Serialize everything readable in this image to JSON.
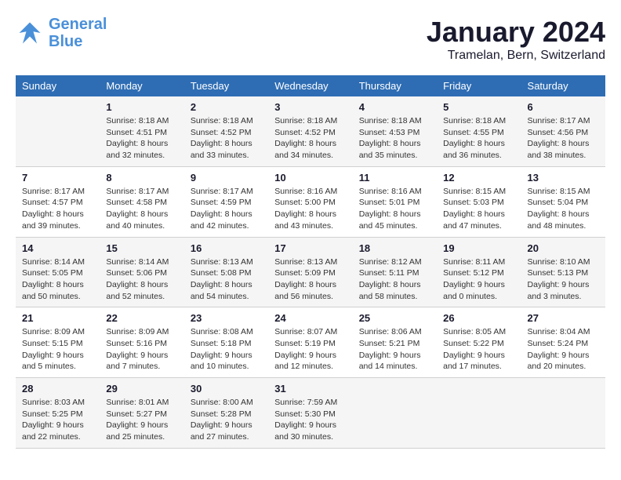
{
  "header": {
    "logo_line1": "General",
    "logo_line2": "Blue",
    "month_title": "January 2024",
    "subtitle": "Tramelan, Bern, Switzerland"
  },
  "weekdays": [
    "Sunday",
    "Monday",
    "Tuesday",
    "Wednesday",
    "Thursday",
    "Friday",
    "Saturday"
  ],
  "weeks": [
    [
      {
        "day": "",
        "info": ""
      },
      {
        "day": "1",
        "info": "Sunrise: 8:18 AM\nSunset: 4:51 PM\nDaylight: 8 hours\nand 32 minutes."
      },
      {
        "day": "2",
        "info": "Sunrise: 8:18 AM\nSunset: 4:52 PM\nDaylight: 8 hours\nand 33 minutes."
      },
      {
        "day": "3",
        "info": "Sunrise: 8:18 AM\nSunset: 4:52 PM\nDaylight: 8 hours\nand 34 minutes."
      },
      {
        "day": "4",
        "info": "Sunrise: 8:18 AM\nSunset: 4:53 PM\nDaylight: 8 hours\nand 35 minutes."
      },
      {
        "day": "5",
        "info": "Sunrise: 8:18 AM\nSunset: 4:55 PM\nDaylight: 8 hours\nand 36 minutes."
      },
      {
        "day": "6",
        "info": "Sunrise: 8:17 AM\nSunset: 4:56 PM\nDaylight: 8 hours\nand 38 minutes."
      }
    ],
    [
      {
        "day": "7",
        "info": "Sunrise: 8:17 AM\nSunset: 4:57 PM\nDaylight: 8 hours\nand 39 minutes."
      },
      {
        "day": "8",
        "info": "Sunrise: 8:17 AM\nSunset: 4:58 PM\nDaylight: 8 hours\nand 40 minutes."
      },
      {
        "day": "9",
        "info": "Sunrise: 8:17 AM\nSunset: 4:59 PM\nDaylight: 8 hours\nand 42 minutes."
      },
      {
        "day": "10",
        "info": "Sunrise: 8:16 AM\nSunset: 5:00 PM\nDaylight: 8 hours\nand 43 minutes."
      },
      {
        "day": "11",
        "info": "Sunrise: 8:16 AM\nSunset: 5:01 PM\nDaylight: 8 hours\nand 45 minutes."
      },
      {
        "day": "12",
        "info": "Sunrise: 8:15 AM\nSunset: 5:03 PM\nDaylight: 8 hours\nand 47 minutes."
      },
      {
        "day": "13",
        "info": "Sunrise: 8:15 AM\nSunset: 5:04 PM\nDaylight: 8 hours\nand 48 minutes."
      }
    ],
    [
      {
        "day": "14",
        "info": "Sunrise: 8:14 AM\nSunset: 5:05 PM\nDaylight: 8 hours\nand 50 minutes."
      },
      {
        "day": "15",
        "info": "Sunrise: 8:14 AM\nSunset: 5:06 PM\nDaylight: 8 hours\nand 52 minutes."
      },
      {
        "day": "16",
        "info": "Sunrise: 8:13 AM\nSunset: 5:08 PM\nDaylight: 8 hours\nand 54 minutes."
      },
      {
        "day": "17",
        "info": "Sunrise: 8:13 AM\nSunset: 5:09 PM\nDaylight: 8 hours\nand 56 minutes."
      },
      {
        "day": "18",
        "info": "Sunrise: 8:12 AM\nSunset: 5:11 PM\nDaylight: 8 hours\nand 58 minutes."
      },
      {
        "day": "19",
        "info": "Sunrise: 8:11 AM\nSunset: 5:12 PM\nDaylight: 9 hours\nand 0 minutes."
      },
      {
        "day": "20",
        "info": "Sunrise: 8:10 AM\nSunset: 5:13 PM\nDaylight: 9 hours\nand 3 minutes."
      }
    ],
    [
      {
        "day": "21",
        "info": "Sunrise: 8:09 AM\nSunset: 5:15 PM\nDaylight: 9 hours\nand 5 minutes."
      },
      {
        "day": "22",
        "info": "Sunrise: 8:09 AM\nSunset: 5:16 PM\nDaylight: 9 hours\nand 7 minutes."
      },
      {
        "day": "23",
        "info": "Sunrise: 8:08 AM\nSunset: 5:18 PM\nDaylight: 9 hours\nand 10 minutes."
      },
      {
        "day": "24",
        "info": "Sunrise: 8:07 AM\nSunset: 5:19 PM\nDaylight: 9 hours\nand 12 minutes."
      },
      {
        "day": "25",
        "info": "Sunrise: 8:06 AM\nSunset: 5:21 PM\nDaylight: 9 hours\nand 14 minutes."
      },
      {
        "day": "26",
        "info": "Sunrise: 8:05 AM\nSunset: 5:22 PM\nDaylight: 9 hours\nand 17 minutes."
      },
      {
        "day": "27",
        "info": "Sunrise: 8:04 AM\nSunset: 5:24 PM\nDaylight: 9 hours\nand 20 minutes."
      }
    ],
    [
      {
        "day": "28",
        "info": "Sunrise: 8:03 AM\nSunset: 5:25 PM\nDaylight: 9 hours\nand 22 minutes."
      },
      {
        "day": "29",
        "info": "Sunrise: 8:01 AM\nSunset: 5:27 PM\nDaylight: 9 hours\nand 25 minutes."
      },
      {
        "day": "30",
        "info": "Sunrise: 8:00 AM\nSunset: 5:28 PM\nDaylight: 9 hours\nand 27 minutes."
      },
      {
        "day": "31",
        "info": "Sunrise: 7:59 AM\nSunset: 5:30 PM\nDaylight: 9 hours\nand 30 minutes."
      },
      {
        "day": "",
        "info": ""
      },
      {
        "day": "",
        "info": ""
      },
      {
        "day": "",
        "info": ""
      }
    ]
  ]
}
